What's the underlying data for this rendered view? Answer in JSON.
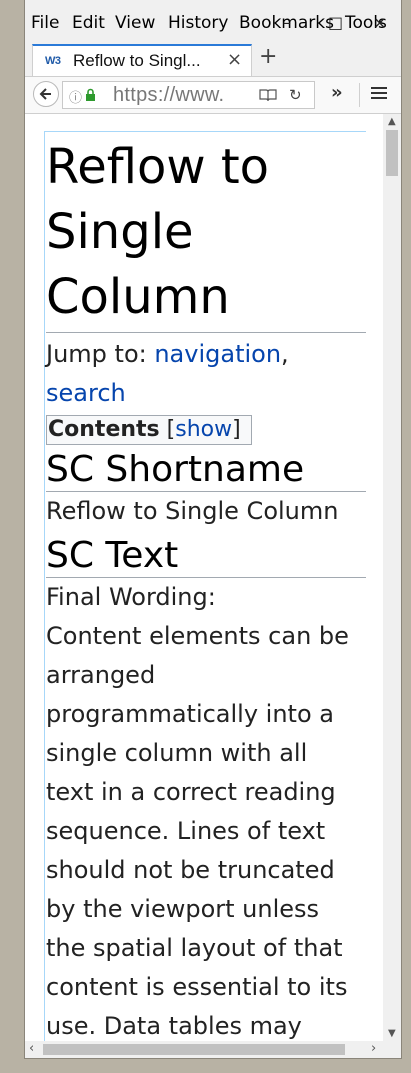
{
  "menu": {
    "file": "File",
    "edit": "Edit",
    "view": "View",
    "history": "History",
    "bookmarks": "Bookmarks",
    "tools": "Tools"
  },
  "window_controls": {
    "minimize": "–",
    "maximize": "□",
    "close": "×"
  },
  "tab": {
    "favicon": "W3",
    "title": "Reflow to Singl...",
    "close": "×",
    "new_tab": "+"
  },
  "navbar": {
    "url": "https://www.",
    "overflow": "»"
  },
  "page": {
    "title_line1": "Reflow to",
    "title_line2": "Single",
    "title_line3": "Column",
    "jump_prefix": "Jump to: ",
    "jump_navigation": "navigation",
    "jump_comma": ",",
    "jump_search": "search",
    "toc_label": "Contents",
    "toc_open": "[",
    "toc_show": "show",
    "toc_close": "]",
    "h2_shortname": "SC Shortname",
    "shortname_text": "Reflow to Single Column",
    "h2_text": "SC Text",
    "final_wording": "Final Wording:",
    "body_lines": [
      "Content elements can be",
      "arranged",
      "programmatically into a",
      "single column with all",
      "text in a correct reading",
      "sequence. Lines of text",
      "should not be truncated",
      "by the viewport unless",
      "the spatial layout of that",
      "content is essential to its",
      "use. Data tables may"
    ]
  },
  "colors": {
    "link": "#0645ad",
    "tab_accent": "#2a7ad8",
    "desktop": "#b8b2a4"
  }
}
